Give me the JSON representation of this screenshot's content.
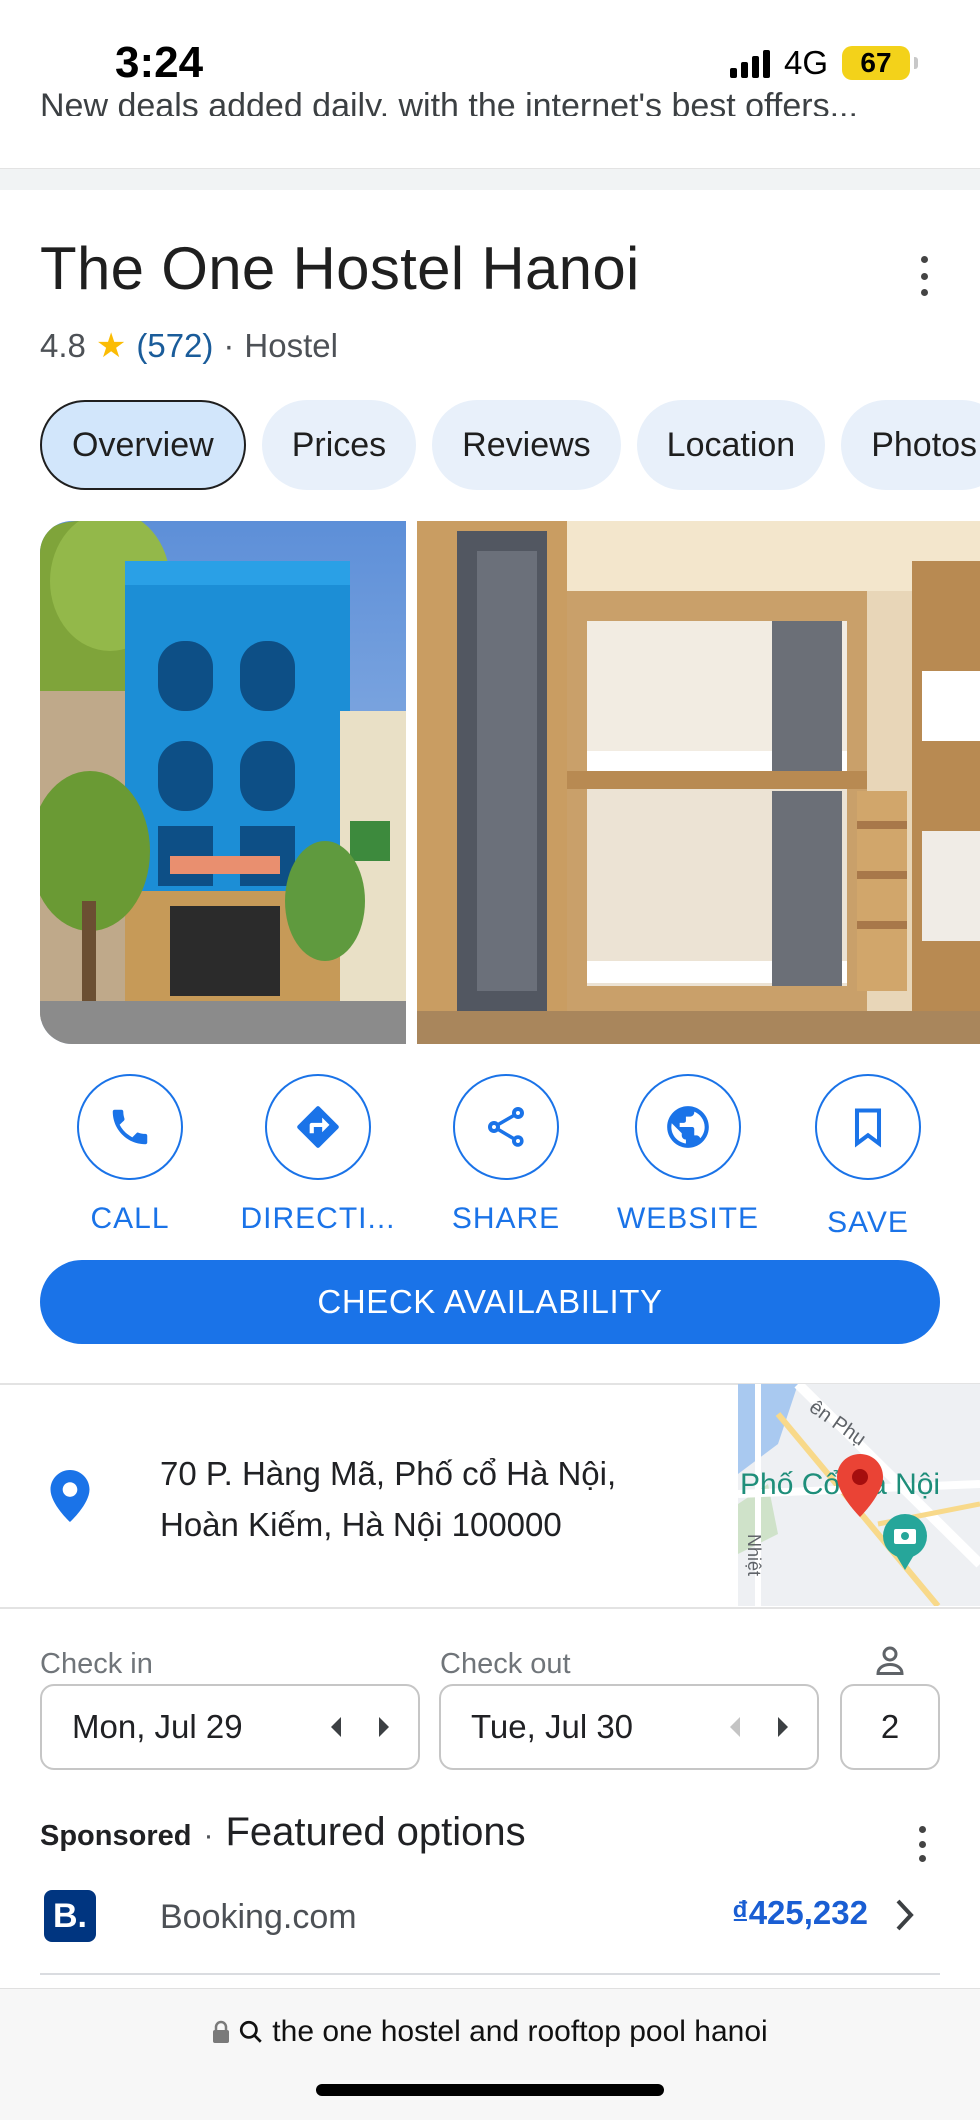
{
  "status_bar": {
    "time": "3:24",
    "network": "4G",
    "battery": "67"
  },
  "banner": {
    "deals_text": "New deals added daily, with the internet's best offers..."
  },
  "place": {
    "name": "The One Hostel Hanoi",
    "rating": "4.8",
    "review_count": "(572)",
    "separator": "·",
    "category": "Hostel"
  },
  "tabs": [
    {
      "label": "Overview",
      "active": true
    },
    {
      "label": "Prices"
    },
    {
      "label": "Reviews"
    },
    {
      "label": "Location"
    },
    {
      "label": "Photos"
    }
  ],
  "actions": {
    "call": "CALL",
    "directions": "DIRECTI...",
    "share": "SHARE",
    "website": "WEBSITE",
    "save": "SAVE"
  },
  "check_availability": "CHECK AVAILABILITY",
  "address": {
    "line1": "70 P. Hàng Mã, Phố cổ Hà Nội,",
    "line2": "Hoàn Kiếm, Hà Nội 100000"
  },
  "map": {
    "label_district": "Phố Cổ Hà Nội",
    "label_street": "ên Phụ",
    "label_side": "Nhiệt"
  },
  "booking": {
    "check_in_label": "Check in",
    "check_in_value": "Mon, Jul 29",
    "check_out_label": "Check out",
    "check_out_value": "Tue, Jul 30",
    "guests": "2"
  },
  "sponsored": {
    "tag": "Sponsored",
    "dot": "·",
    "title": "Featured options",
    "provider_logo": "B.",
    "provider_name": "Booking.com",
    "price": "₫425,232"
  },
  "url_bar": {
    "query": "the one hostel and rooftop pool hanoi"
  },
  "colors": {
    "accent": "#1a73e8",
    "star": "#fbbc04",
    "booking_brand": "#003580"
  }
}
